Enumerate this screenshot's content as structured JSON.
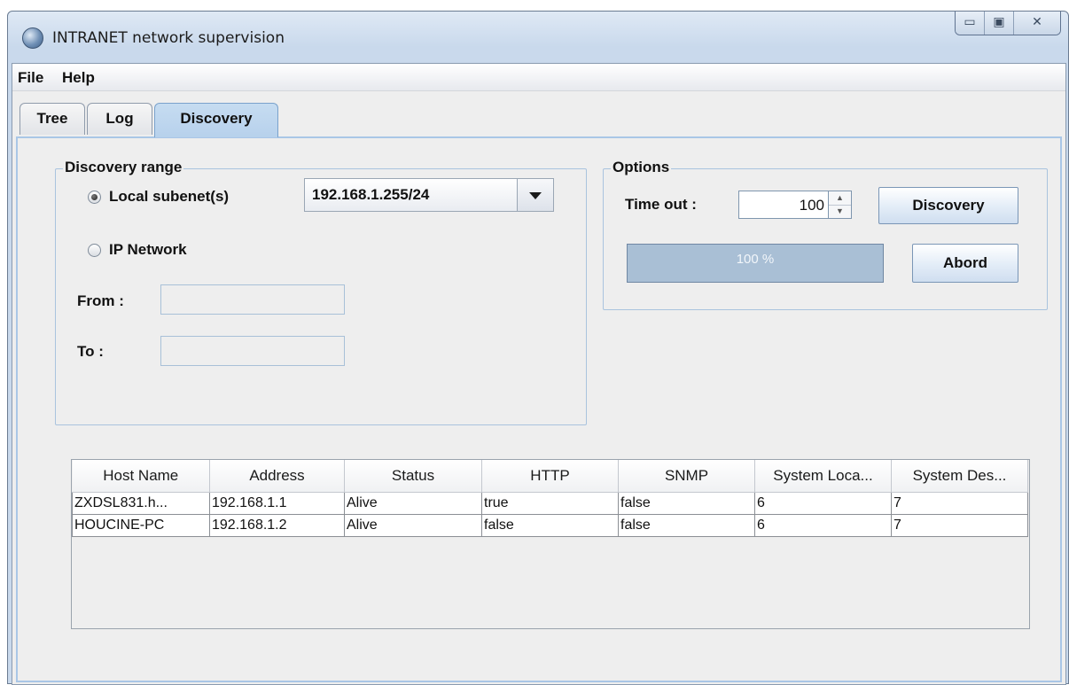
{
  "window": {
    "title": "INTRANET network supervision",
    "icon": "globe-icon",
    "controls": {
      "minimize": "▭",
      "maximize": "▣",
      "close": "✕"
    }
  },
  "menu": {
    "file": "File",
    "help": "Help"
  },
  "tabs": [
    {
      "label": "Tree"
    },
    {
      "label": "Log"
    },
    {
      "label": "Discovery",
      "selected": true
    }
  ],
  "discovery_range": {
    "title": "Discovery range",
    "local_subnet_label": "Local subenet(s)",
    "local_subnet_selected": true,
    "subnet_value": "192.168.1.255/24",
    "ip_network_label": "IP Network",
    "ip_network_selected": false,
    "from_label": "From :",
    "from_value": "",
    "to_label": "To :",
    "to_value": ""
  },
  "options": {
    "title": "Options",
    "timeout_label": "Time out :",
    "timeout_value": "100",
    "discovery_button": "Discovery",
    "abort_button": "Abord",
    "progress_text": "100 %",
    "progress_fraction": 1.0
  },
  "table": {
    "columns": [
      "Host Name",
      "Address",
      "Status",
      "HTTP",
      "SNMP",
      "System Loca...",
      "System Des..."
    ],
    "rows": [
      [
        "ZXDSL831.h...",
        "192.168.1.1",
        "Alive",
        "true",
        "false",
        "6",
        "7"
      ],
      [
        "HOUCINE-PC",
        "192.168.1.2",
        "Alive",
        "false",
        "false",
        "6",
        "7"
      ]
    ]
  }
}
